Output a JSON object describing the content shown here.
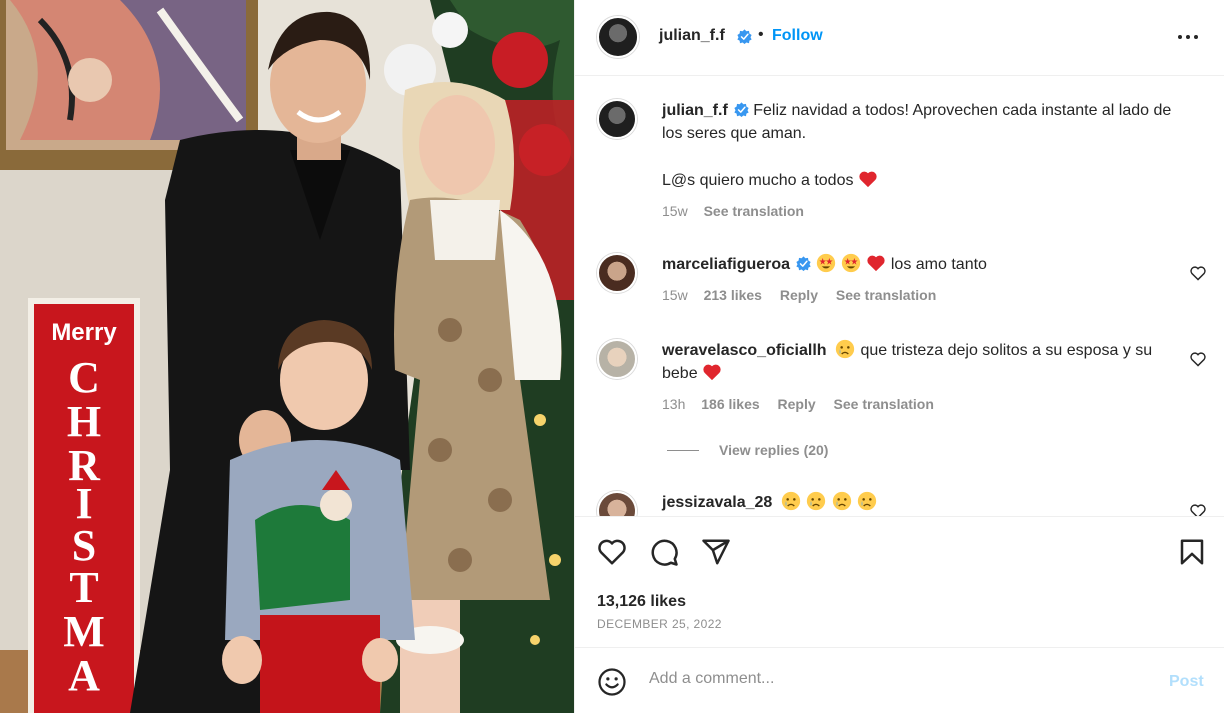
{
  "header": {
    "username": "julian_f.f",
    "separator": "•",
    "follow_label": "Follow",
    "verified_icon": "verified-badge-icon",
    "more_icon": "more-options-icon"
  },
  "caption": {
    "username": "julian_f.f",
    "text": "Feliz navidad a todos! Aprovechen cada instante al lado de los seres que aman.",
    "text2": "L@s quiero mucho a todos",
    "time": "15w",
    "see_translation": "See translation"
  },
  "comments": [
    {
      "username": "marceliafigueroa",
      "verified": true,
      "emojis": [
        "star-struck-emoji",
        "star-struck-emoji",
        "red-heart-emoji"
      ],
      "text": "los amo tanto",
      "time": "15w",
      "likes": "213 likes",
      "reply": "Reply",
      "see_translation": "See translation"
    },
    {
      "username": "weravelasco_oficiallh",
      "verified": false,
      "text_before": "que tristeza dejo solitos a su esposa y su bebe",
      "time": "13h",
      "likes": "186 likes",
      "reply": "Reply",
      "see_translation": "See translation",
      "view_replies": "View replies (20)"
    },
    {
      "username": "jessizavala_28",
      "verified": false,
      "emojis": [
        "crying-emoji",
        "crying-emoji",
        "crying-emoji",
        "crying-emoji"
      ]
    }
  ],
  "actions": {
    "like_icon": "heart-icon",
    "comment_icon": "comment-icon",
    "share_icon": "send-icon",
    "save_icon": "bookmark-icon",
    "likes_count": "13,126 likes",
    "date": "DECEMBER 25, 2022"
  },
  "add_comment": {
    "placeholder": "Add a comment...",
    "post_label": "Post",
    "emoji_icon": "smile-icon"
  },
  "photo": {
    "sign_word1": "Merry",
    "sign_word2": "CHRISTMAS"
  },
  "colors": {
    "accent": "#0095f6",
    "post_disabled": "#b2dffc",
    "like_red": "#ed4956",
    "muted": "#8e8e8e"
  }
}
